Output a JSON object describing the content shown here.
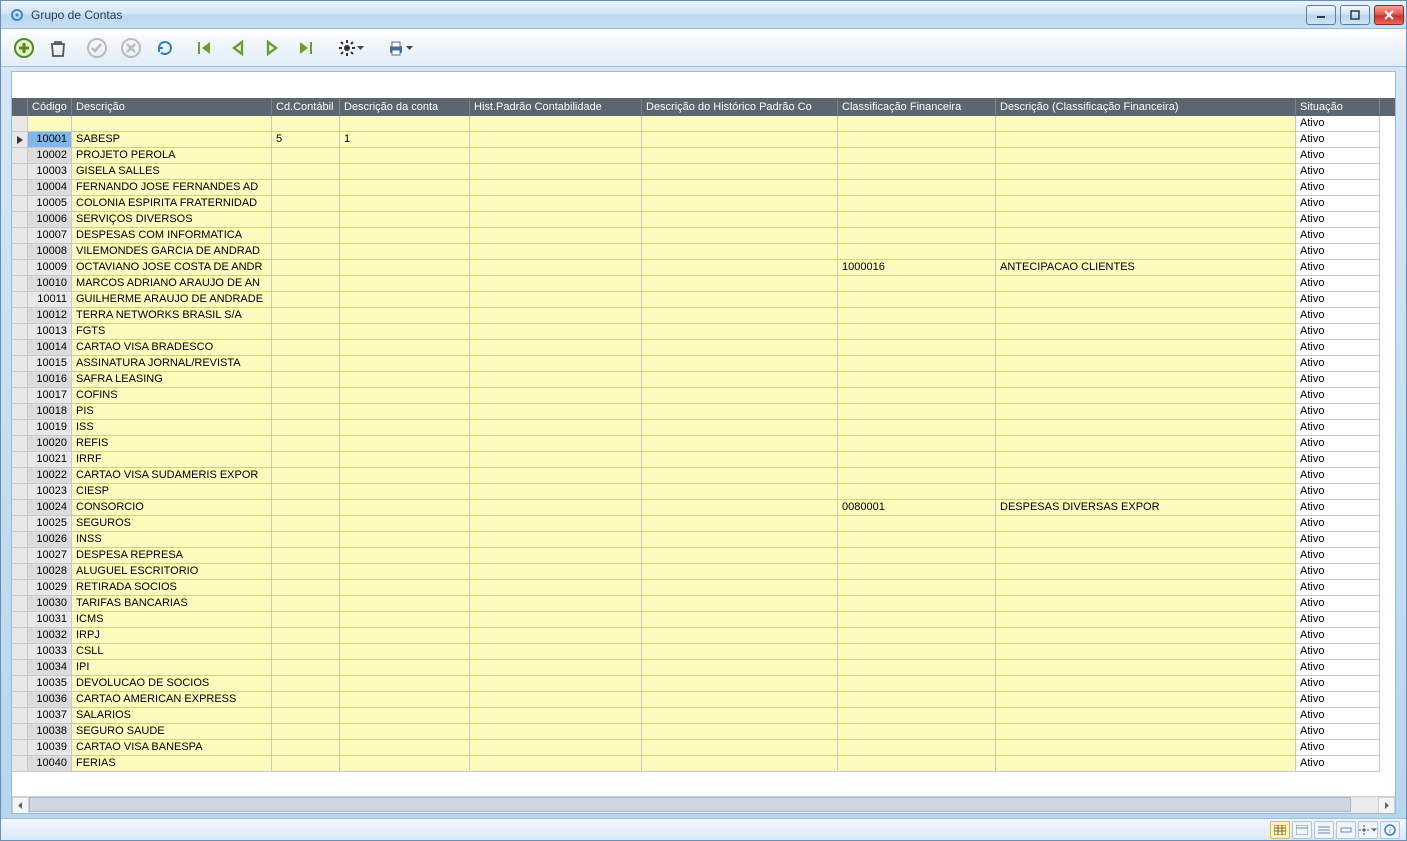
{
  "window": {
    "title": "Grupo de Contas"
  },
  "columns": {
    "codigo": "Código",
    "descricao": "Descrição",
    "cdContabil": "Cd.Contábil",
    "descConta": "Descrição da conta",
    "histPadrao": "Hist.Padrão Contabilidade",
    "descHistPadrao": "Descrição do Histórico Padrão Co",
    "classFin": "Classificação Financeira",
    "descClassFin": "Descrição (Classificação Financeira)",
    "situacao": "Situação"
  },
  "filterRow": {
    "situacao": "Ativo"
  },
  "rows": [
    {
      "codigo": "10001",
      "descricao": "SABESP",
      "cdContabil": "5",
      "descConta": "1",
      "histPadrao": "",
      "descHistPadrao": "",
      "classFin": "",
      "descClassFin": "",
      "situacao": "Ativo",
      "selected": true
    },
    {
      "codigo": "10002",
      "descricao": "PROJETO PEROLA",
      "cdContabil": "",
      "descConta": "",
      "histPadrao": "",
      "descHistPadrao": "",
      "classFin": "",
      "descClassFin": "",
      "situacao": "Ativo"
    },
    {
      "codigo": "10003",
      "descricao": "GISELA SALLES",
      "cdContabil": "",
      "descConta": "",
      "histPadrao": "",
      "descHistPadrao": "",
      "classFin": "",
      "descClassFin": "",
      "situacao": "Ativo"
    },
    {
      "codigo": "10004",
      "descricao": "FERNANDO JOSE FERNANDES AD",
      "cdContabil": "",
      "descConta": "",
      "histPadrao": "",
      "descHistPadrao": "",
      "classFin": "",
      "descClassFin": "",
      "situacao": "Ativo"
    },
    {
      "codigo": "10005",
      "descricao": "COLONIA ESPIRITA FRATERNIDAD",
      "cdContabil": "",
      "descConta": "",
      "histPadrao": "",
      "descHistPadrao": "",
      "classFin": "",
      "descClassFin": "",
      "situacao": "Ativo"
    },
    {
      "codigo": "10006",
      "descricao": "SERVIÇOS DIVERSOS",
      "cdContabil": "",
      "descConta": "",
      "histPadrao": "",
      "descHistPadrao": "",
      "classFin": "",
      "descClassFin": "",
      "situacao": "Ativo"
    },
    {
      "codigo": "10007",
      "descricao": "DESPESAS COM INFORMATICA",
      "cdContabil": "",
      "descConta": "",
      "histPadrao": "",
      "descHistPadrao": "",
      "classFin": "",
      "descClassFin": "",
      "situacao": "Ativo"
    },
    {
      "codigo": "10008",
      "descricao": "VILEMONDES GARCIA DE ANDRAD",
      "cdContabil": "",
      "descConta": "",
      "histPadrao": "",
      "descHistPadrao": "",
      "classFin": "",
      "descClassFin": "",
      "situacao": "Ativo"
    },
    {
      "codigo": "10009",
      "descricao": "OCTAVIANO JOSE COSTA DE ANDR",
      "cdContabil": "",
      "descConta": "",
      "histPadrao": "",
      "descHistPadrao": "",
      "classFin": "1000016",
      "descClassFin": "ANTECIPACAO CLIENTES",
      "situacao": "Ativo"
    },
    {
      "codigo": "10010",
      "descricao": "MARCOS ADRIANO ARAUJO DE AN",
      "cdContabil": "",
      "descConta": "",
      "histPadrao": "",
      "descHistPadrao": "",
      "classFin": "",
      "descClassFin": "",
      "situacao": "Ativo"
    },
    {
      "codigo": "10011",
      "descricao": "GUILHERME ARAUJO DE ANDRADE",
      "cdContabil": "",
      "descConta": "",
      "histPadrao": "",
      "descHistPadrao": "",
      "classFin": "",
      "descClassFin": "",
      "situacao": "Ativo"
    },
    {
      "codigo": "10012",
      "descricao": "TERRA NETWORKS BRASIL S/A",
      "cdContabil": "",
      "descConta": "",
      "histPadrao": "",
      "descHistPadrao": "",
      "classFin": "",
      "descClassFin": "",
      "situacao": "Ativo"
    },
    {
      "codigo": "10013",
      "descricao": "FGTS",
      "cdContabil": "",
      "descConta": "",
      "histPadrao": "",
      "descHistPadrao": "",
      "classFin": "",
      "descClassFin": "",
      "situacao": "Ativo"
    },
    {
      "codigo": "10014",
      "descricao": "CARTAO VISA BRADESCO",
      "cdContabil": "",
      "descConta": "",
      "histPadrao": "",
      "descHistPadrao": "",
      "classFin": "",
      "descClassFin": "",
      "situacao": "Ativo"
    },
    {
      "codigo": "10015",
      "descricao": "ASSINATURA JORNAL/REVISTA",
      "cdContabil": "",
      "descConta": "",
      "histPadrao": "",
      "descHistPadrao": "",
      "classFin": "",
      "descClassFin": "",
      "situacao": "Ativo"
    },
    {
      "codigo": "10016",
      "descricao": "SAFRA LEASING",
      "cdContabil": "",
      "descConta": "",
      "histPadrao": "",
      "descHistPadrao": "",
      "classFin": "",
      "descClassFin": "",
      "situacao": "Ativo"
    },
    {
      "codigo": "10017",
      "descricao": "COFINS",
      "cdContabil": "",
      "descConta": "",
      "histPadrao": "",
      "descHistPadrao": "",
      "classFin": "",
      "descClassFin": "",
      "situacao": "Ativo"
    },
    {
      "codigo": "10018",
      "descricao": "PIS",
      "cdContabil": "",
      "descConta": "",
      "histPadrao": "",
      "descHistPadrao": "",
      "classFin": "",
      "descClassFin": "",
      "situacao": "Ativo"
    },
    {
      "codigo": "10019",
      "descricao": "ISS",
      "cdContabil": "",
      "descConta": "",
      "histPadrao": "",
      "descHistPadrao": "",
      "classFin": "",
      "descClassFin": "",
      "situacao": "Ativo"
    },
    {
      "codigo": "10020",
      "descricao": "REFIS",
      "cdContabil": "",
      "descConta": "",
      "histPadrao": "",
      "descHistPadrao": "",
      "classFin": "",
      "descClassFin": "",
      "situacao": "Ativo"
    },
    {
      "codigo": "10021",
      "descricao": "IRRF",
      "cdContabil": "",
      "descConta": "",
      "histPadrao": "",
      "descHistPadrao": "",
      "classFin": "",
      "descClassFin": "",
      "situacao": "Ativo"
    },
    {
      "codigo": "10022",
      "descricao": "CARTAO VISA SUDAMERIS EXPOR",
      "cdContabil": "",
      "descConta": "",
      "histPadrao": "",
      "descHistPadrao": "",
      "classFin": "",
      "descClassFin": "",
      "situacao": "Ativo"
    },
    {
      "codigo": "10023",
      "descricao": "CIESP",
      "cdContabil": "",
      "descConta": "",
      "histPadrao": "",
      "descHistPadrao": "",
      "classFin": "",
      "descClassFin": "",
      "situacao": "Ativo"
    },
    {
      "codigo": "10024",
      "descricao": "CONSORCIO",
      "cdContabil": "",
      "descConta": "",
      "histPadrao": "",
      "descHistPadrao": "",
      "classFin": "0080001",
      "descClassFin": "DESPESAS DIVERSAS EXPOR",
      "situacao": "Ativo"
    },
    {
      "codigo": "10025",
      "descricao": "SEGUROS",
      "cdContabil": "",
      "descConta": "",
      "histPadrao": "",
      "descHistPadrao": "",
      "classFin": "",
      "descClassFin": "",
      "situacao": "Ativo"
    },
    {
      "codigo": "10026",
      "descricao": "INSS",
      "cdContabil": "",
      "descConta": "",
      "histPadrao": "",
      "descHistPadrao": "",
      "classFin": "",
      "descClassFin": "",
      "situacao": "Ativo"
    },
    {
      "codigo": "10027",
      "descricao": "DESPESA REPRESA",
      "cdContabil": "",
      "descConta": "",
      "histPadrao": "",
      "descHistPadrao": "",
      "classFin": "",
      "descClassFin": "",
      "situacao": "Ativo"
    },
    {
      "codigo": "10028",
      "descricao": "ALUGUEL ESCRITORIO",
      "cdContabil": "",
      "descConta": "",
      "histPadrao": "",
      "descHistPadrao": "",
      "classFin": "",
      "descClassFin": "",
      "situacao": "Ativo"
    },
    {
      "codigo": "10029",
      "descricao": "RETIRADA SOCIOS",
      "cdContabil": "",
      "descConta": "",
      "histPadrao": "",
      "descHistPadrao": "",
      "classFin": "",
      "descClassFin": "",
      "situacao": "Ativo"
    },
    {
      "codigo": "10030",
      "descricao": "TARIFAS BANCARIAS",
      "cdContabil": "",
      "descConta": "",
      "histPadrao": "",
      "descHistPadrao": "",
      "classFin": "",
      "descClassFin": "",
      "situacao": "Ativo"
    },
    {
      "codigo": "10031",
      "descricao": "ICMS",
      "cdContabil": "",
      "descConta": "",
      "histPadrao": "",
      "descHistPadrao": "",
      "classFin": "",
      "descClassFin": "",
      "situacao": "Ativo"
    },
    {
      "codigo": "10032",
      "descricao": "IRPJ",
      "cdContabil": "",
      "descConta": "",
      "histPadrao": "",
      "descHistPadrao": "",
      "classFin": "",
      "descClassFin": "",
      "situacao": "Ativo"
    },
    {
      "codigo": "10033",
      "descricao": "CSLL",
      "cdContabil": "",
      "descConta": "",
      "histPadrao": "",
      "descHistPadrao": "",
      "classFin": "",
      "descClassFin": "",
      "situacao": "Ativo"
    },
    {
      "codigo": "10034",
      "descricao": "IPI",
      "cdContabil": "",
      "descConta": "",
      "histPadrao": "",
      "descHistPadrao": "",
      "classFin": "",
      "descClassFin": "",
      "situacao": "Ativo"
    },
    {
      "codigo": "10035",
      "descricao": "DEVOLUCAO DE SOCIOS",
      "cdContabil": "",
      "descConta": "",
      "histPadrao": "",
      "descHistPadrao": "",
      "classFin": "",
      "descClassFin": "",
      "situacao": "Ativo"
    },
    {
      "codigo": "10036",
      "descricao": "CARTAO AMERICAN EXPRESS",
      "cdContabil": "",
      "descConta": "",
      "histPadrao": "",
      "descHistPadrao": "",
      "classFin": "",
      "descClassFin": "",
      "situacao": "Ativo"
    },
    {
      "codigo": "10037",
      "descricao": "SALARIOS",
      "cdContabil": "",
      "descConta": "",
      "histPadrao": "",
      "descHistPadrao": "",
      "classFin": "",
      "descClassFin": "",
      "situacao": "Ativo"
    },
    {
      "codigo": "10038",
      "descricao": "SEGURO SAUDE",
      "cdContabil": "",
      "descConta": "",
      "histPadrao": "",
      "descHistPadrao": "",
      "classFin": "",
      "descClassFin": "",
      "situacao": "Ativo"
    },
    {
      "codigo": "10039",
      "descricao": "CARTAO VISA BANESPA",
      "cdContabil": "",
      "descConta": "",
      "histPadrao": "",
      "descHistPadrao": "",
      "classFin": "",
      "descClassFin": "",
      "situacao": "Ativo"
    },
    {
      "codigo": "10040",
      "descricao": "FERIAS",
      "cdContabil": "",
      "descConta": "",
      "histPadrao": "",
      "descHistPadrao": "",
      "classFin": "",
      "descClassFin": "",
      "situacao": "Ativo"
    }
  ]
}
